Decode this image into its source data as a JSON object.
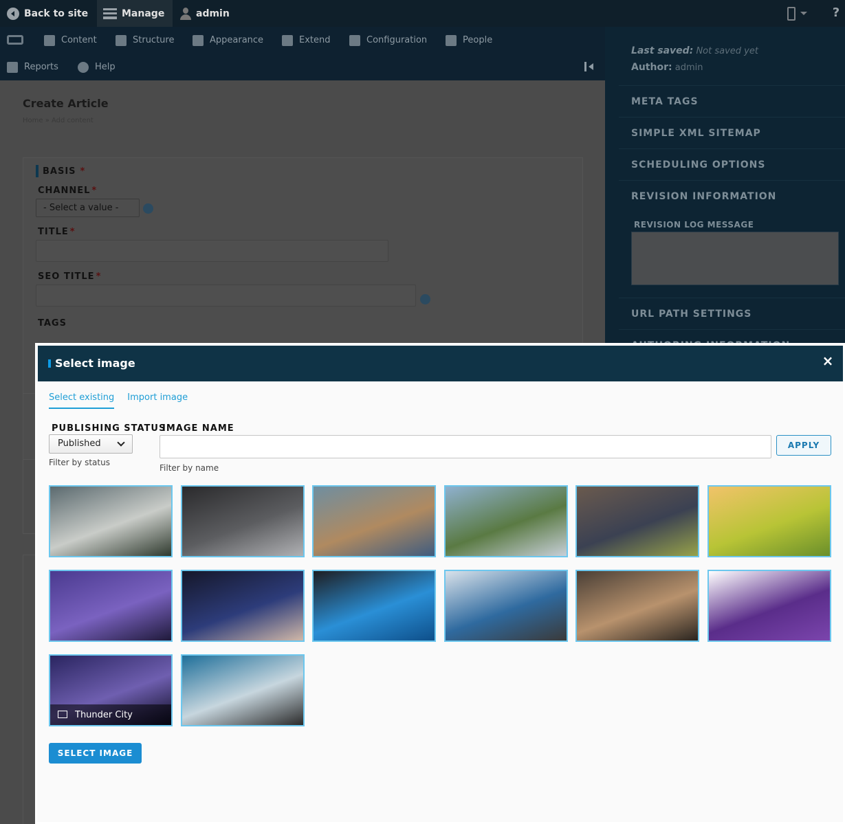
{
  "toolbar": {
    "back_to_site": "Back to site",
    "manage": "Manage",
    "user": "admin"
  },
  "tray": {
    "items": [
      "Content",
      "Structure",
      "Appearance",
      "Extend",
      "Configuration",
      "People",
      "Reports",
      "Help"
    ]
  },
  "page": {
    "title": "Create Article",
    "breadcrumb": "Home » Add content"
  },
  "form": {
    "section": "BASIS",
    "required_mark": "*",
    "channel_label": "CHANNEL",
    "channel_value": "- Select a value -",
    "title_label": "TITLE",
    "seo_title_label": "SEO TITLE",
    "tags_label": "TAGS"
  },
  "sidebar": {
    "last_saved_label": "Last saved:",
    "last_saved_value": "Not saved yet",
    "author_label": "Author:",
    "author_value": "admin",
    "sections": [
      "META TAGS",
      "SIMPLE XML SITEMAP",
      "SCHEDULING OPTIONS",
      "REVISION INFORMATION",
      "URL PATH SETTINGS"
    ],
    "revision_log_label": "REVISION LOG MESSAGE",
    "cut_off_section": "AUTHORING INFORMATION"
  },
  "modal": {
    "title": "Select image",
    "close": "×",
    "tabs": [
      "Select existing",
      "Import image"
    ],
    "status_label": "PUBLISHING STATUS",
    "status_value": "Published",
    "status_desc": "Filter by status",
    "name_label": "IMAGE NAME",
    "name_value": "",
    "name_desc": "Filter by name",
    "apply": "APPLY",
    "select_button": "SELECT IMAGE",
    "images": [
      {
        "colors": [
          "#5b6a6f",
          "#c9ccc8",
          "#2f3a2e"
        ],
        "caption": ""
      },
      {
        "colors": [
          "#2a2a2c",
          "#5c5d60",
          "#b0b1b4"
        ],
        "caption": ""
      },
      {
        "colors": [
          "#6f8ea0",
          "#b08a60",
          "#3f5c7f"
        ],
        "caption": ""
      },
      {
        "colors": [
          "#8fb1cf",
          "#5a7a43",
          "#c7cfd8"
        ],
        "caption": ""
      },
      {
        "colors": [
          "#6a5a4e",
          "#3b4152",
          "#97a24a"
        ],
        "caption": ""
      },
      {
        "colors": [
          "#f1c36a",
          "#b8c436",
          "#6a8f2a"
        ],
        "caption": ""
      },
      {
        "colors": [
          "#4a3a8f",
          "#7a62c0",
          "#1f1a3a"
        ],
        "caption": ""
      },
      {
        "colors": [
          "#15172a",
          "#2d3c7a",
          "#d0b8a8"
        ],
        "caption": ""
      },
      {
        "colors": [
          "#1e1e22",
          "#2a8fd6",
          "#0e4f8a"
        ],
        "caption": ""
      },
      {
        "colors": [
          "#d9e2ea",
          "#2f6a9f",
          "#3a3a3a"
        ],
        "caption": ""
      },
      {
        "colors": [
          "#4a3f36",
          "#b8926d",
          "#2a2520"
        ],
        "caption": ""
      },
      {
        "colors": [
          "#ffffff",
          "#5a2d8a",
          "#7b45ad"
        ],
        "caption": ""
      },
      {
        "colors": [
          "#2a2560",
          "#6f5fb0",
          "#0e0c24"
        ],
        "caption": "Thunder City"
      },
      {
        "colors": [
          "#1f6f9a",
          "#c7d6de",
          "#2b2b2b"
        ],
        "caption": ""
      }
    ]
  }
}
